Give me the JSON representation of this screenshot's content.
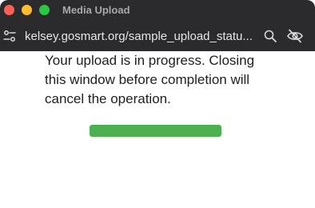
{
  "window": {
    "title": "Media Upload"
  },
  "addressbar": {
    "url": "kelsey.gosmart.org/sample_upload_statu..."
  },
  "icons": {
    "site_settings": "site-settings-icon",
    "zoom": "magnifier-icon",
    "hide": "eye-slash-icon"
  },
  "main": {
    "message": "Your upload is in progress. Closing this window before completion will cancel the operation.",
    "progress_fraction": 1.0
  },
  "colors": {
    "progress": "#4caf50",
    "titlebar": "#2b2b2d"
  }
}
